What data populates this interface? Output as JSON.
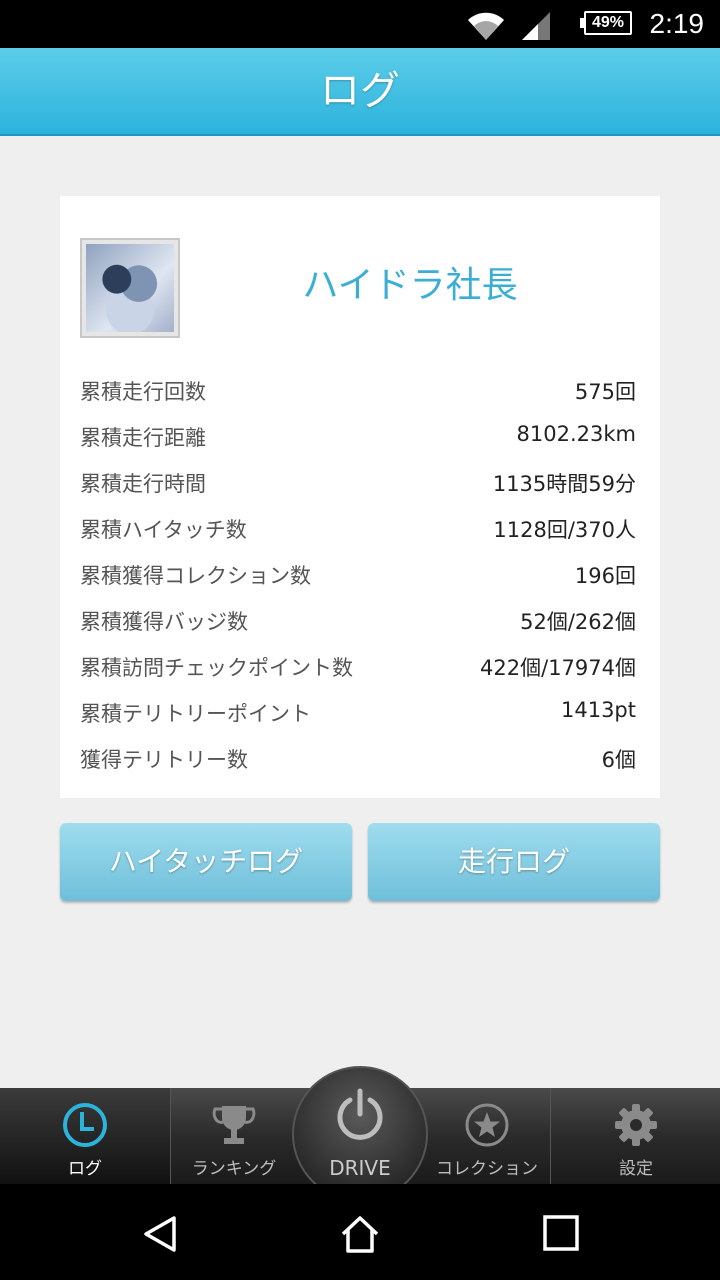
{
  "status_bar": {
    "battery": "49%",
    "time": "2:19"
  },
  "header": {
    "title": "ログ"
  },
  "profile": {
    "name": "ハイドラ社長"
  },
  "stats": [
    {
      "label": "累積走行回数",
      "value": "575回"
    },
    {
      "label": "累積走行距離",
      "value": "8102.23km"
    },
    {
      "label": "累積走行時間",
      "value": "1135時間59分"
    },
    {
      "label": "累積ハイタッチ数",
      "value": "1128回/370人"
    },
    {
      "label": "累積獲得コレクション数",
      "value": "196回"
    },
    {
      "label": "累積獲得バッジ数",
      "value": "52個/262個"
    },
    {
      "label": "累積訪問チェックポイント数",
      "value": "422個/17974個"
    },
    {
      "label": "累積テリトリーポイント",
      "value": "1413pt"
    },
    {
      "label": "獲得テリトリー数",
      "value": "6個"
    }
  ],
  "buttons": {
    "hitouch_log": "ハイタッチログ",
    "drive_log": "走行ログ"
  },
  "tabs": {
    "log": "ログ",
    "ranking": "ランキング",
    "drive": "DRIVE",
    "collection": "コレクション",
    "settings": "設定"
  },
  "colors": {
    "accent": "#2cb3dc",
    "name_color": "#3aaed3",
    "button": "#7fc8e0"
  }
}
